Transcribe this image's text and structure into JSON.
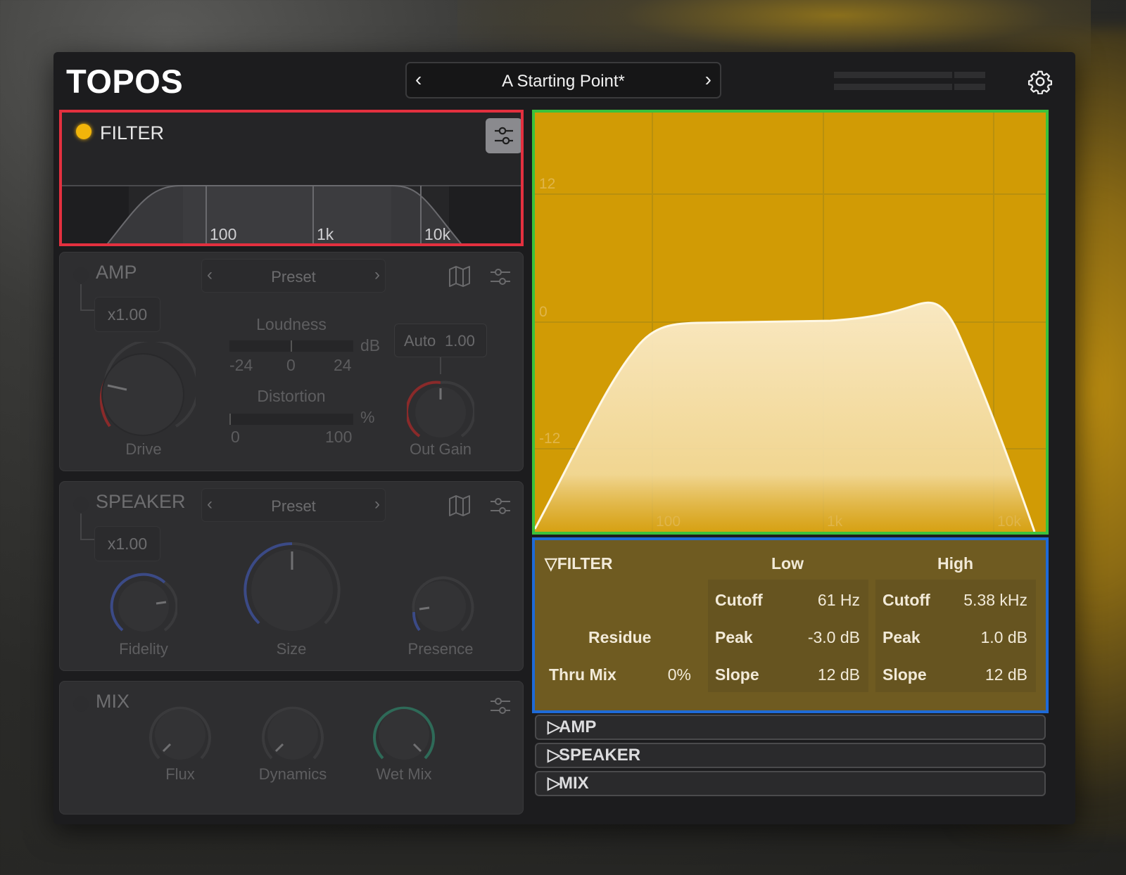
{
  "app": {
    "title": "TOPOS"
  },
  "preset": {
    "name": "A Starting Point*"
  },
  "filter_panel": {
    "title": "FILTER",
    "freq_labels": [
      "100",
      "1k",
      "10k"
    ]
  },
  "amp": {
    "title": "AMP",
    "preset": "Preset",
    "multiplier": "x1.00",
    "loudness_label": "Loudness",
    "loudness_unit": "dB",
    "loudness_scale": [
      "-24",
      "0",
      "24"
    ],
    "distortion_label": "Distortion",
    "distortion_unit": "%",
    "distortion_scale": [
      "0",
      "100"
    ],
    "auto_label": "Auto",
    "auto_value": "1.00",
    "knobs": [
      "Drive",
      "Out Gain"
    ]
  },
  "speaker": {
    "title": "SPEAKER",
    "preset": "Preset",
    "multiplier": "x1.00",
    "knobs": [
      "Fidelity",
      "Size",
      "Presence"
    ]
  },
  "mix": {
    "title": "MIX",
    "knobs": [
      "Flux",
      "Dynamics",
      "Wet Mix"
    ]
  },
  "graph": {
    "y_labels": [
      "12",
      "0",
      "-12"
    ],
    "x_labels": [
      "100",
      "1k",
      "10k"
    ]
  },
  "details": {
    "title": "FILTER",
    "low_header": "Low",
    "high_header": "High",
    "residue_label": "Residue",
    "thru_mix_label": "Thru Mix",
    "thru_mix_value": "0%",
    "low": {
      "cutoff_label": "Cutoff",
      "cutoff_value": "61 Hz",
      "peak_label": "Peak",
      "peak_value": "-3.0 dB",
      "slope_label": "Slope",
      "slope_value": "12 dB"
    },
    "high": {
      "cutoff_label": "Cutoff",
      "cutoff_value": "5.38 kHz",
      "peak_label": "Peak",
      "peak_value": "1.0 dB",
      "slope_label": "Slope",
      "slope_value": "12 dB"
    }
  },
  "sections": {
    "amp": "AMP",
    "speaker": "SPEAKER",
    "mix": "MIX"
  },
  "colors": {
    "accent": "#f2b50a",
    "graph_bg": "#d19b05"
  }
}
